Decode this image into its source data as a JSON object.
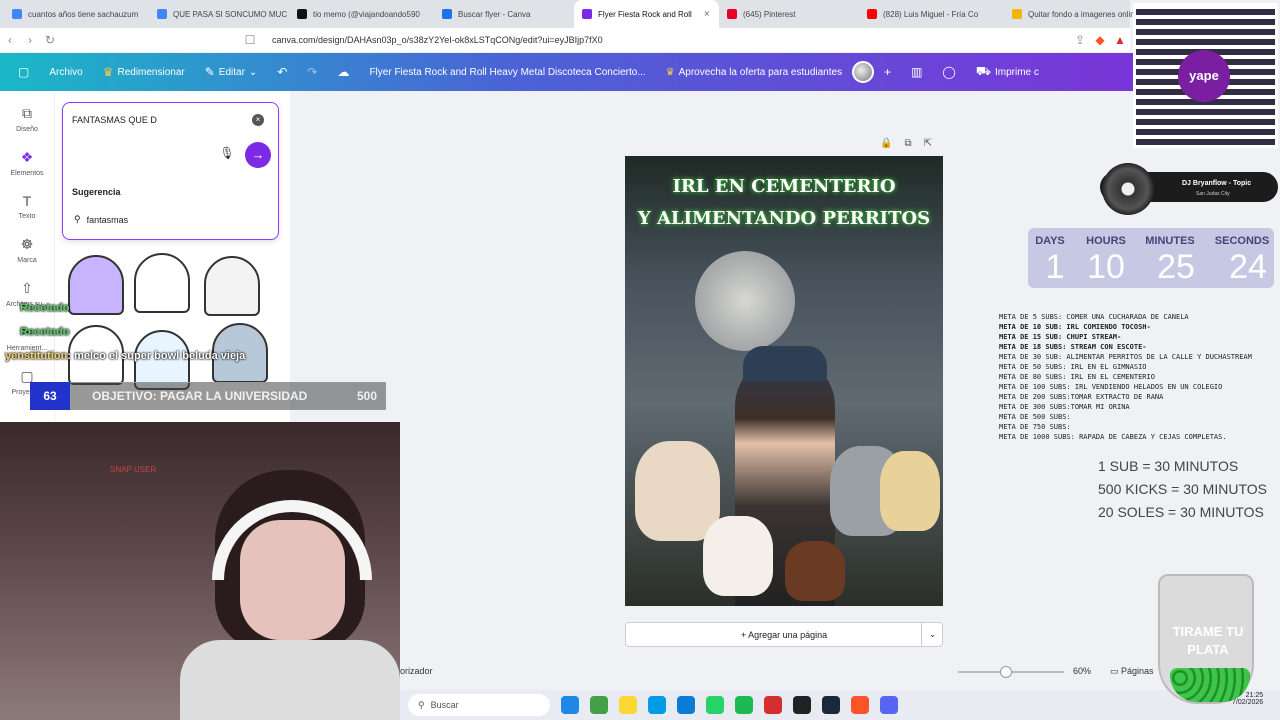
{
  "browser": {
    "tabs": [
      {
        "label": "cuantos años tiene sachauzum",
        "color": "#4285f4"
      },
      {
        "label": "QUE PASA SI SONCUMO MUC",
        "color": "#4285f4"
      },
      {
        "label": "tio memo (@viajandoando590",
        "color": "#111111"
      },
      {
        "label": "Buscar flyer - Canva",
        "color": "#1a73e8"
      },
      {
        "label": "Flyer Fiesta Rock and Roll",
        "color": "#7d2ae8"
      },
      {
        "label": "(645) Pinterest",
        "color": "#e60023"
      },
      {
        "label": "(828) Luis Miguel - Fría Co",
        "color": "#ff0000"
      },
      {
        "label": "Quitar fondo a imagenes onlin",
        "color": "#f4b400"
      }
    ],
    "tab_close": "×",
    "url": "canva.com/design/DAHAsn03p_o/s38zY2YeI-ok8xLSTqCONg/edit?ui=eyJBIjp7fX0"
  },
  "canva_toolbar": {
    "archivo": "Archivo",
    "redimensionar": "Redimensionar",
    "editar": "Editar",
    "doc_title": "Flyer Fiesta Rock and Roll Heavy Metal Discoteca Concierto...",
    "promo": "Aprovecha la oferta para estudiantes",
    "imprime": "Imprime c"
  },
  "sidebar": {
    "items": [
      {
        "label": "Diseño",
        "icon": "layout-icon"
      },
      {
        "label": "Elementos",
        "icon": "elements-icon"
      },
      {
        "label": "Texto",
        "icon": "text-icon"
      },
      {
        "label": "Marca",
        "icon": "brand-icon"
      },
      {
        "label": "Archivos su...",
        "icon": "upload-icon"
      },
      {
        "label": "Herramient...",
        "icon": "tools-icon"
      },
      {
        "label": "Proyectos",
        "icon": "folder-icon"
      }
    ]
  },
  "search": {
    "value": "FANTASMAS QUE D",
    "suggestion_header": "Sugerencia",
    "suggestion": "fantasmas"
  },
  "stream": {
    "chat1": "Recetado",
    "chat2": "Recetado",
    "chat3_user": "yenstitution",
    "chat3_msg": ": melco el super bowl beluda vieja",
    "goal_current": "63",
    "goal_text": "OBJETIVO: PAGAR LA UNIVERSIDAD",
    "goal_target": "500",
    "webcam_sign": "SNAP USER"
  },
  "poster": {
    "line1": "IRL EN CEMENTERIO",
    "line2": "Y ALIMENTANDO PERRITOS"
  },
  "canvas": {
    "add_page": "+ Agregar una página",
    "notes": "orizador",
    "zoom": "60%",
    "pages": "Páginas",
    "zoom_fraction": 0.45
  },
  "taskbar": {
    "search_placeholder": "Buscar",
    "time": "21:25",
    "date": "7/02/2026",
    "icons": [
      "#1e88e5",
      "#43a047",
      "#fdd835",
      "#039be5",
      "#0a7cd6",
      "#25d366",
      "#1db954",
      "#d32f2f",
      "#222222",
      "#1b2838",
      "#fb542b",
      "#5865f2"
    ]
  },
  "overlays": {
    "spotify_title": "DJ Bryanflow - Topic",
    "spotify_sub": "San Judas City",
    "yape": "yape",
    "countdown": [
      {
        "label": "DAYS",
        "value": "1"
      },
      {
        "label": "HOURS",
        "value": "10"
      },
      {
        "label": "MINUTES",
        "value": "25"
      },
      {
        "label": "SECONDS",
        "value": "24"
      }
    ],
    "goals": [
      {
        "text": "META DE 5 SUBS: COMER UNA CUCHARADA DE CANELA",
        "bold": false
      },
      {
        "text": "META DE 10 SUB: IRL COMIENDO TOCOSH-",
        "bold": true
      },
      {
        "text": "META DE 15 SUB: CHUPI STREAM-",
        "bold": true
      },
      {
        "text": "META DE 18 SUBS: STREAM CON ESCOTE-",
        "bold": true
      },
      {
        "text": "META DE 30 SUB:  ALIMENTAR PERRITOS DE LA CALLE Y DUCHASTREAM",
        "bold": false
      },
      {
        "text": "META DE 50 SUBS: IRL EN EL GIMNASIO",
        "bold": false
      },
      {
        "text": "META DE 80 SUBS: IRL EN EL CEMENTERIO",
        "bold": false
      },
      {
        "text": "META DE 100 SUBS: IRL VENDIENDO HELADOS EN UN COLEGIO",
        "bold": false
      },
      {
        "text": "META DE 200 SUBS:TOMAR EXTRACTO DE RANA",
        "bold": false
      },
      {
        "text": "META DE 300 SUBS:TOMAR MI ORINA",
        "bold": false
      },
      {
        "text": "META DE 500 SUBS:",
        "bold": false
      },
      {
        "text": "META DE 750 SUBS:",
        "bold": false
      },
      {
        "text": "META DE 1000 SUBS: RAPADA DE CABEZA Y CEJAS COMPLETAS.",
        "bold": false
      }
    ],
    "rates": [
      "1 SUB = 30 MINUTOS",
      "500 KICKS = 30 MINUTOS",
      "20 SOLES = 30 MINUTOS"
    ],
    "jar_text": "TIRAME TU PLATA"
  }
}
